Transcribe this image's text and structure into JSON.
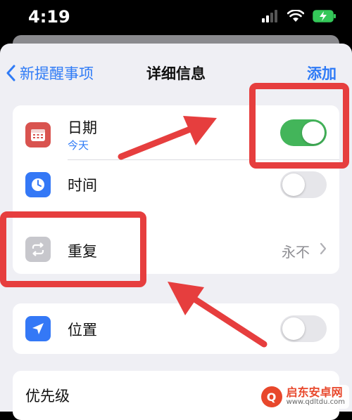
{
  "status_bar": {
    "time": "4:19"
  },
  "nav": {
    "back_label": "新提醒事项",
    "title": "详细信息",
    "add_label": "添加"
  },
  "rows": {
    "date": {
      "label": "日期",
      "sublabel": "今天",
      "toggle": "on",
      "icon": "calendar-icon",
      "icon_color": "#d9534f"
    },
    "time": {
      "label": "时间",
      "toggle": "off",
      "icon": "clock-icon",
      "icon_color": "#3478f6"
    },
    "repeat": {
      "label": "重复",
      "value": "永不",
      "icon": "repeat-icon",
      "icon_color": "#c7c7cc"
    },
    "location": {
      "label": "位置",
      "toggle": "off",
      "icon": "location-arrow-icon",
      "icon_color": "#3478f6"
    },
    "priority": {
      "label": "优先级"
    }
  },
  "colors": {
    "accent": "#2f7bf6",
    "toggle_on": "#43b55a",
    "annotation_red": "#e63e3e"
  },
  "watermark": {
    "name": "启东安卓网",
    "url": "www.qdltdu.com"
  }
}
